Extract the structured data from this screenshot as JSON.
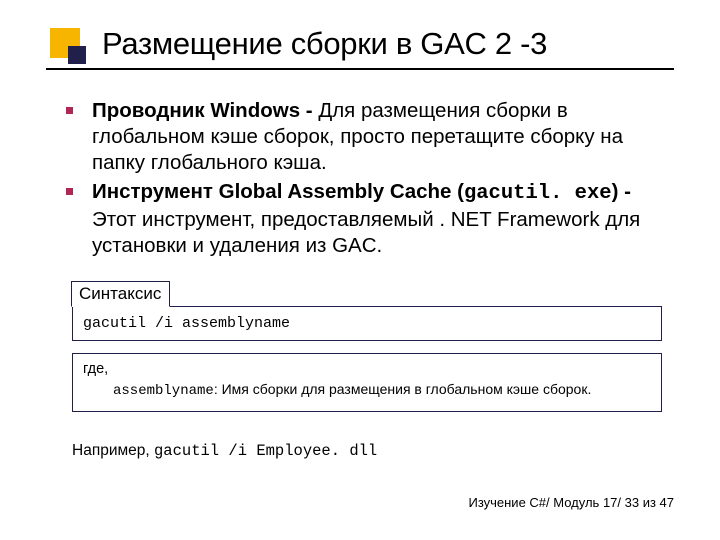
{
  "title": "Размещение сборки в GAC 2 -3",
  "bullets": [
    {
      "bold": "Проводник Windows - ",
      "rest": "Для размещения сборки в глобальном кэше сборок, просто перетащите сборку на папку глобального кэша."
    },
    {
      "bold": "Инструмент Global Assembly Cache (",
      "mono": "gacutil. exe",
      "afterMono": ") - ",
      "rest": "Этот инструмент, предоставляемый . NET Framework для установки и удаления из GAC."
    }
  ],
  "syntax": {
    "label": "Синтаксис",
    "code": "gacutil /i assemblyname",
    "where": "где,",
    "defMono": "assemblyname",
    "defRest": ": Имя сборки для размещения в глобальном кэше сборок."
  },
  "example": {
    "label": "Например, ",
    "code": "gacutil /i Employee. dll"
  },
  "footer": "Изучение C#/ Модуль 17/ 33 из 47"
}
